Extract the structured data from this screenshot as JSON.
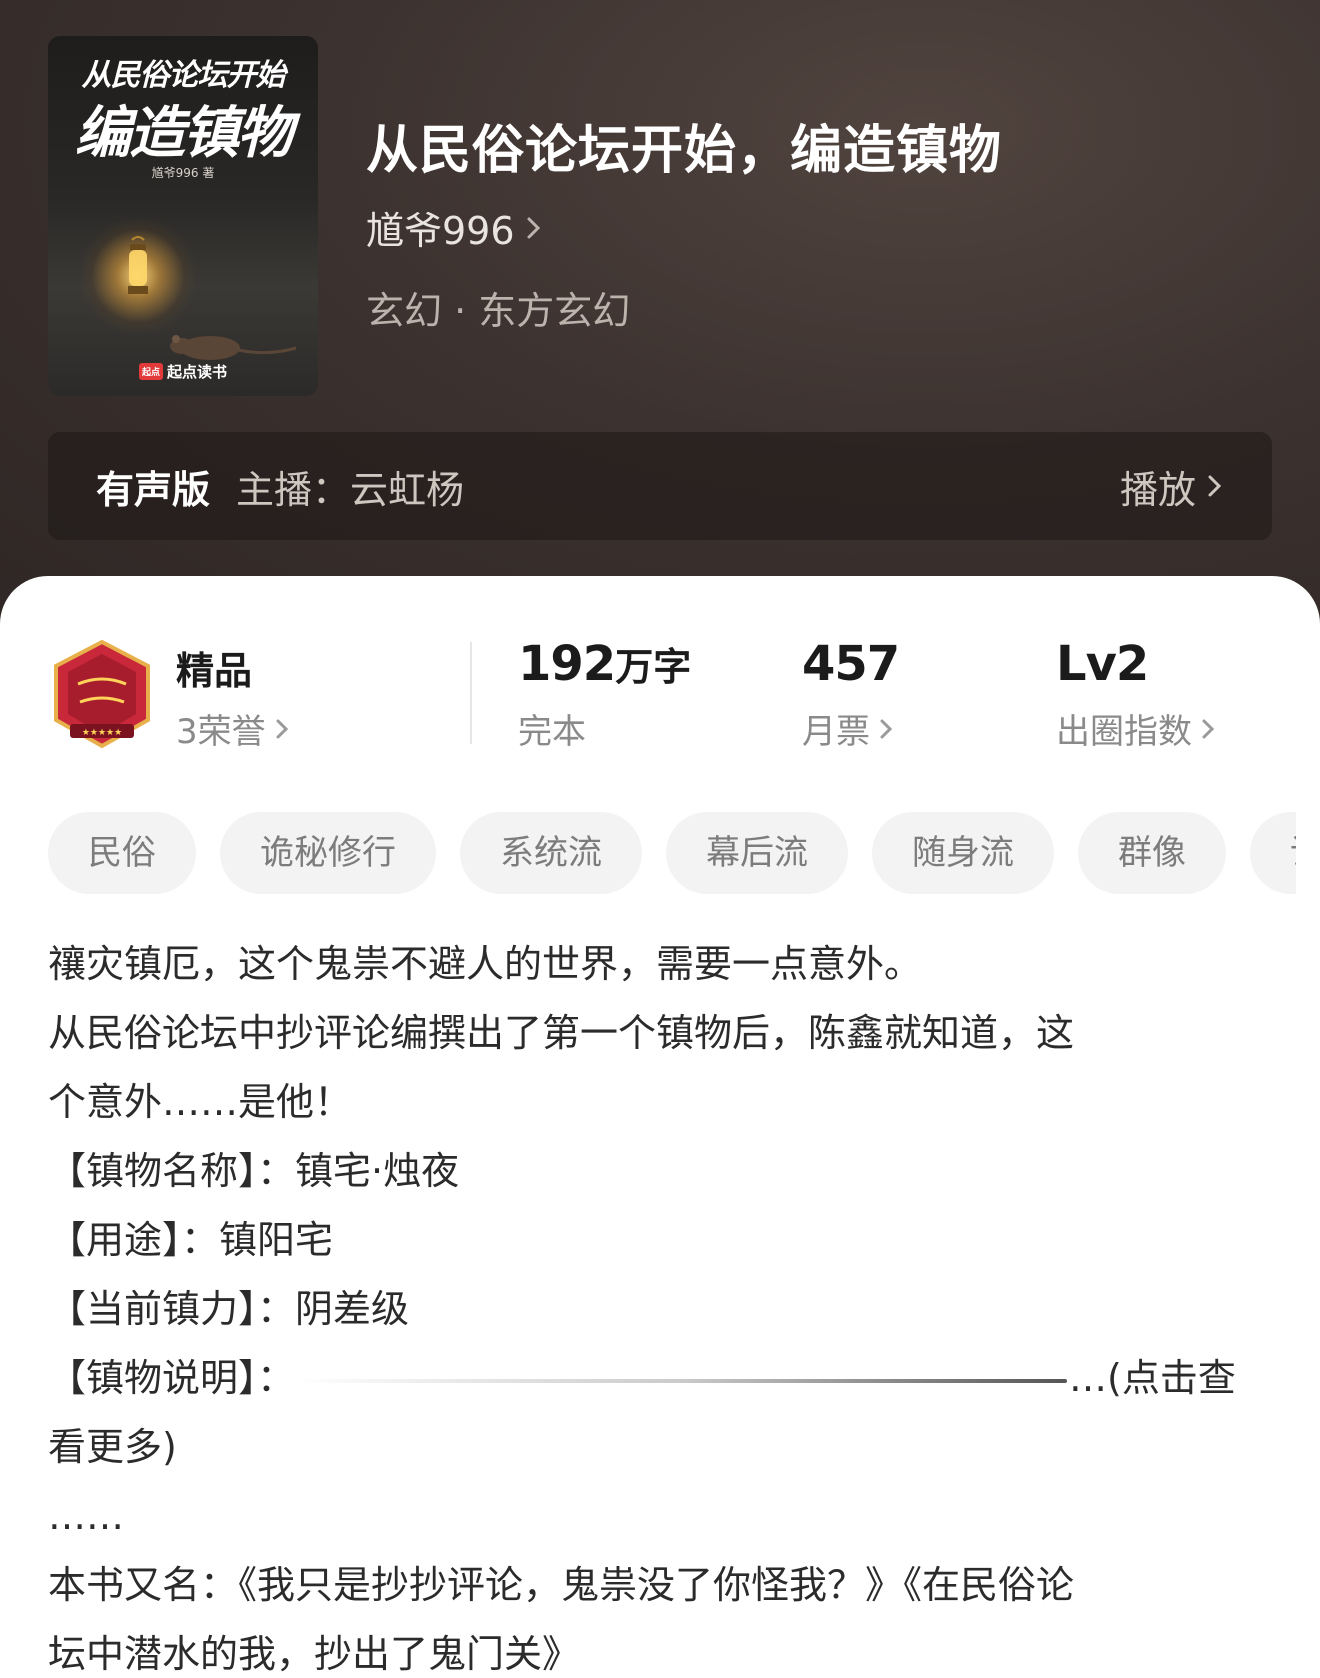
{
  "book": {
    "cover": {
      "title_line1": "从民俗论坛开始",
      "title_line2": "编造镇物",
      "author_text": "馗爷996 著",
      "brand_mark": "起点",
      "brand": "起点读书"
    },
    "title": "从民俗论坛开始，编造镇物",
    "author": "馗爷996",
    "genre": "玄幻 · 东方玄幻"
  },
  "audio": {
    "label": "有声版",
    "host": "主播：云虹杨",
    "play": "播放"
  },
  "stats": {
    "quality": {
      "title": "精品",
      "sub": "3荣誉"
    },
    "words": {
      "value": "192",
      "unit": "万字",
      "sub": "完本"
    },
    "tickets": {
      "value": "457",
      "sub": "月票"
    },
    "level": {
      "value": "Lv2",
      "sub": "出圈指数"
    }
  },
  "tags": [
    "民俗",
    "诡秘修行",
    "系统流",
    "幕后流",
    "随身流",
    "群像",
    "诡"
  ],
  "synopsis": {
    "lines": [
      "禳灾镇厄，这个鬼祟不避人的世界，需要一点意外。",
      "从民俗论坛中抄评论编撰出了第一个镇物后，陈鑫就知道，这",
      "个意外……是他！",
      "【镇物名称】：镇宅·烛夜",
      "【用途】：镇阳宅",
      "【当前镇力】：阴差级"
    ],
    "desc_label": "【镇物说明】：",
    "desc_more": "…(点击查",
    "desc_more2": "看更多)",
    "ellipsis": "……",
    "alias_line1": "本书又名：《我只是抄抄评论，鬼祟没了你怪我？》《在民俗论",
    "alias_line2": "坛中潜水的我，抄出了鬼门关》"
  },
  "colors": {
    "hero_bg": "#3a302d",
    "card_bg": "#ffffff",
    "tag_bg": "#f3f3f3",
    "badge_red": "#c8283a",
    "brand_red": "#e23a3a"
  }
}
